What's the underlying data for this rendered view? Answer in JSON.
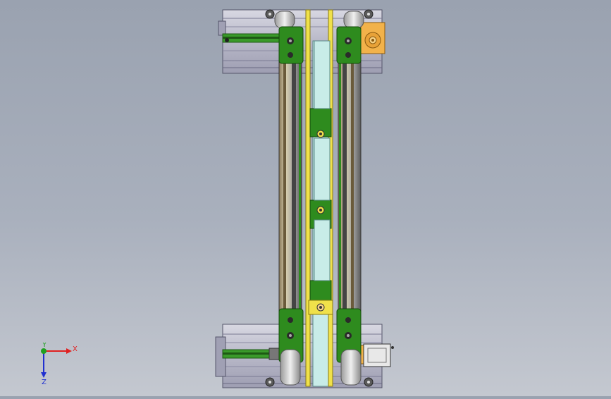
{
  "app": {
    "view_name": "cad-3d-viewport"
  },
  "triad": {
    "x_label": "X",
    "z_label": "Z",
    "y_label": "Y"
  },
  "colors": {
    "background_top": "#9aa2b0",
    "background_bottom": "#c4c8d0",
    "profile": "#c8c8d4",
    "profile_dark": "#6f6f86",
    "bracket_green": "#2e8b1e",
    "rail_yellow": "#f0e14a",
    "panel_cyan": "#c8ece8",
    "motor_orange": "#f2b24a",
    "pillar_grey": "#e2e2e2",
    "axis_x": "#e02020",
    "axis_z": "#2030d0",
    "axis_y": "#20a020"
  },
  "icons": {
    "orientation_triad": "xyz-axis-triad-icon"
  }
}
